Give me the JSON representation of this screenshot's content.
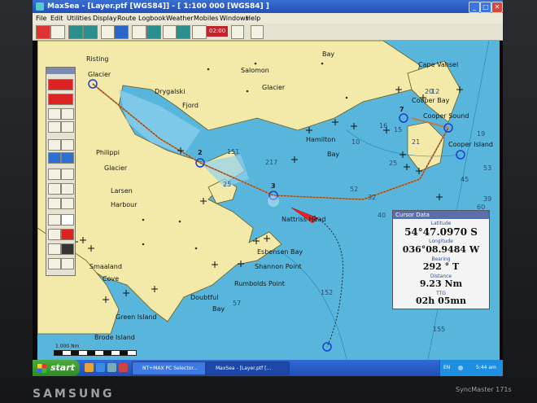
{
  "window": {
    "title": "MaxSea - [Layer.ptf [WGS84]] - [ 1:100 000 [WGS84] ]",
    "menus": [
      "File",
      "Edit",
      "Utilities",
      "Display",
      "Route",
      "Logbook",
      "Weather",
      "Mobiles",
      "Windows",
      "Help"
    ],
    "toolbar_time": "02:00"
  },
  "map": {
    "labels": [
      "Risting",
      "Glacier",
      "Drygalski",
      "Fjord",
      "Salomon",
      "Glacier",
      "Bay",
      "Cape Vahsel",
      "Cooper Bay",
      "Cooper Sound",
      "Cooper Island",
      "Hamilton",
      "Bay",
      "Philippi",
      "Glacier",
      "Larsen",
      "Harbour",
      "Nattriss Head",
      "Esbensen Bay",
      "Shannon Point",
      "Rumbolds Point",
      "Smaaland",
      "Cove",
      "Doubtful",
      "Bay",
      "Green Island",
      "Brode Island"
    ],
    "depths": [
      "151",
      "217",
      "25",
      "25",
      "32",
      "40",
      "52",
      "53",
      "60",
      "16",
      "15",
      "19",
      "21",
      "20",
      "12",
      "10",
      "45",
      "39",
      "57",
      "152",
      "155",
      "57"
    ],
    "waypoints": [
      "2",
      "3",
      "7"
    ],
    "scale_label": "1.000 Nm"
  },
  "cursor_data": {
    "title": "Cursor Data",
    "latitude_label": "Latitude",
    "latitude": "54°47.0970 S",
    "longitude_label": "Longitude",
    "longitude": "036°08.9484 W",
    "bearing_label": "Bearing",
    "bearing": "292 ° T",
    "distance_label": "Distance",
    "distance": "9.23 Nm",
    "ttg_label": "TTG",
    "ttg": "02h 05mn"
  },
  "taskbar": {
    "start": "start",
    "tasks": [
      "NT+MAX PC Selector...",
      "MaxSea - [Layer.ptf [..."
    ],
    "lang": "EN",
    "clock": "5:44 am"
  },
  "monitor": {
    "brand": "SAMSUNG",
    "model": "SyncMaster 171s"
  }
}
